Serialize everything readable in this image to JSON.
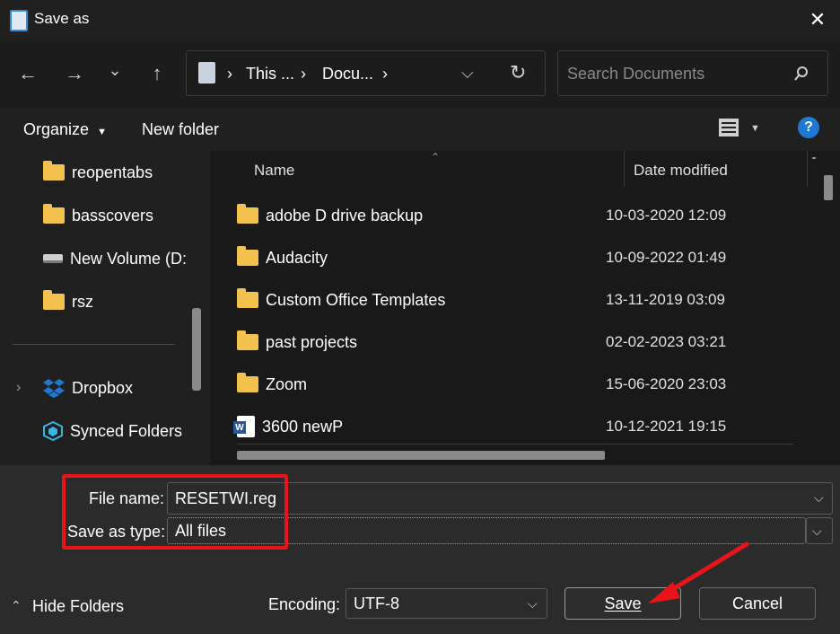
{
  "window": {
    "title": "Save as",
    "close_glyph": "✕"
  },
  "nav": {
    "back_glyph": "←",
    "forward_glyph": "→",
    "recent_glyph": "⌄",
    "up_glyph": "↑",
    "breadcrumbs": [
      "This ...",
      "Docu..."
    ],
    "separator": "›",
    "refresh_glyph": "↻",
    "search_placeholder": "Search Documents"
  },
  "toolbar": {
    "organize_label": "Organize",
    "new_folder_label": "New folder",
    "help_label": "?"
  },
  "sidebar": {
    "items": [
      {
        "label": "reopentabs",
        "icon": "folder-icon"
      },
      {
        "label": "basscovers",
        "icon": "folder-icon"
      },
      {
        "label": "New Volume (D:",
        "icon": "drive-icon"
      },
      {
        "label": "rsz",
        "icon": "folder-icon"
      },
      {
        "label": "Dropbox",
        "icon": "dropbox-icon"
      },
      {
        "label": "Synced Folders",
        "icon": "synced-folder-icon"
      }
    ]
  },
  "filelist": {
    "columns": {
      "name": "Name",
      "date": "Date modified"
    },
    "rows": [
      {
        "name": "adobe D drive backup",
        "date": "10-03-2020 12:09",
        "type": "folder"
      },
      {
        "name": "Audacity",
        "date": "10-09-2022 01:49",
        "type": "folder"
      },
      {
        "name": "Custom Office Templates",
        "date": "13-11-2019 03:09",
        "type": "folder"
      },
      {
        "name": "past projects",
        "date": "02-02-2023 03:21",
        "type": "folder"
      },
      {
        "name": "Zoom",
        "date": "15-06-2020 23:03",
        "type": "folder"
      },
      {
        "name": "3600 newP",
        "date": "10-12-2021 19:15",
        "type": "word"
      }
    ]
  },
  "form": {
    "file_name_label": "File name:",
    "file_name_value": "RESETWI.reg",
    "save_type_label": "Save as type:",
    "save_type_value": "All files",
    "encoding_label": "Encoding:",
    "encoding_value": "UTF-8",
    "hide_folders_label": "Hide Folders",
    "save_label": "Save",
    "cancel_label": "Cancel"
  },
  "colors": {
    "highlight": "#e8141a",
    "accent": "#1f78d1",
    "folder": "#f2c14e"
  }
}
